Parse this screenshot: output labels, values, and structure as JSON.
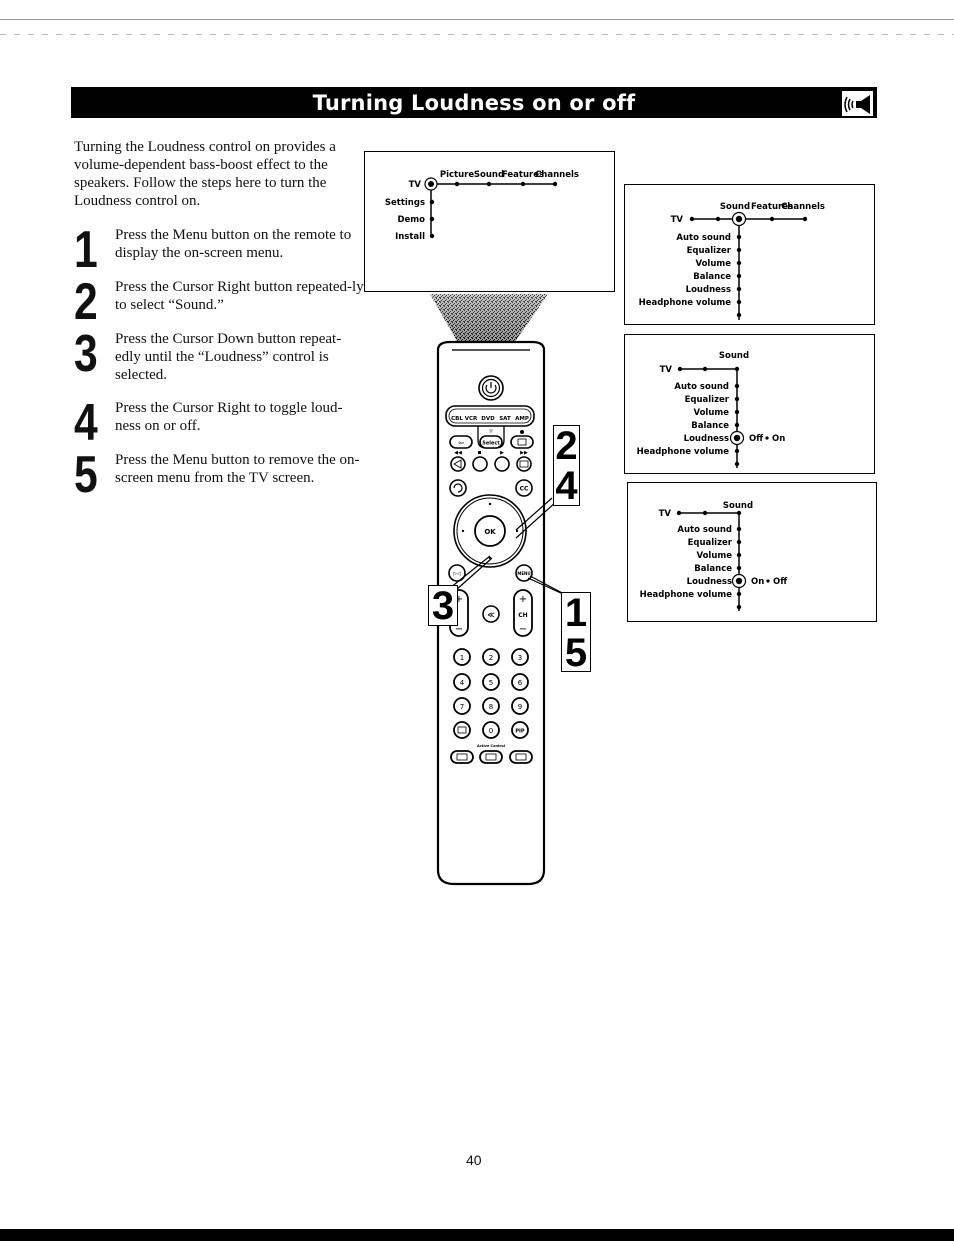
{
  "header": {
    "title": "Turning Loudness on or off",
    "icon": "speaker-loudness-icon"
  },
  "intro": "Turning the Loudness control on provides a volume-dependent bass-boost effect to the speakers.  Follow the steps here to turn the Loudness control on.",
  "steps": [
    {
      "number": "1",
      "text": "Press the Menu button on the remote to display the on-screen menu."
    },
    {
      "number": "2",
      "text": "Press the Cursor Right button repeated-ly to select “Sound.”"
    },
    {
      "number": "3",
      "text": "Press the Cursor Down button repeat-edly until the “Loudness” control is selected."
    },
    {
      "number": "4",
      "text": "Press the Cursor Right to toggle loud-ness on or off."
    },
    {
      "number": "5",
      "text": "Press the Menu button to remove the on-screen menu from the TV screen."
    }
  ],
  "menus": {
    "main": {
      "root": "TV",
      "top": [
        "Picture",
        "Sound",
        "Features",
        "Channels"
      ],
      "side": [
        "Settings",
        "Demo",
        "Install"
      ]
    },
    "sound_selected": {
      "root": "TV",
      "top": [
        "Sound",
        "Features",
        "Channels"
      ],
      "side": [
        "Auto sound",
        "Equalizer",
        "Volume",
        "Balance",
        "Loudness",
        "Headphone volume"
      ]
    },
    "loudness_off": {
      "root": "TV",
      "heading": "Sound",
      "side": [
        "Auto sound",
        "Equalizer",
        "Volume",
        "Balance",
        "Loudness",
        "Headphone volume"
      ],
      "option_a": "Off",
      "option_b": "On"
    },
    "loudness_on": {
      "root": "TV",
      "heading": "Sound",
      "side": [
        "Auto sound",
        "Equalizer",
        "Volume",
        "Balance",
        "Loudness",
        "Headphone volume"
      ],
      "option_a": "On",
      "option_b": "Off"
    }
  },
  "remote": {
    "source_buttons": [
      "CBL",
      "VCR",
      "DVD",
      "SAT",
      "AMP"
    ],
    "select_label": "Select",
    "ok_label": "OK",
    "menu_label": "MENU",
    "cc_label": "CC",
    "ch_label": "CH",
    "plus": "+",
    "minus": "−",
    "digits": [
      "1",
      "2",
      "3",
      "4",
      "5",
      "6",
      "7",
      "8",
      "9",
      "0"
    ],
    "pip_label": "PIP",
    "active_control_label": "Active Control"
  },
  "callouts": {
    "right_upper": [
      "2",
      "4"
    ],
    "left": "3",
    "right_lower": [
      "1",
      "5"
    ]
  },
  "footer": {
    "page_number": "40"
  }
}
